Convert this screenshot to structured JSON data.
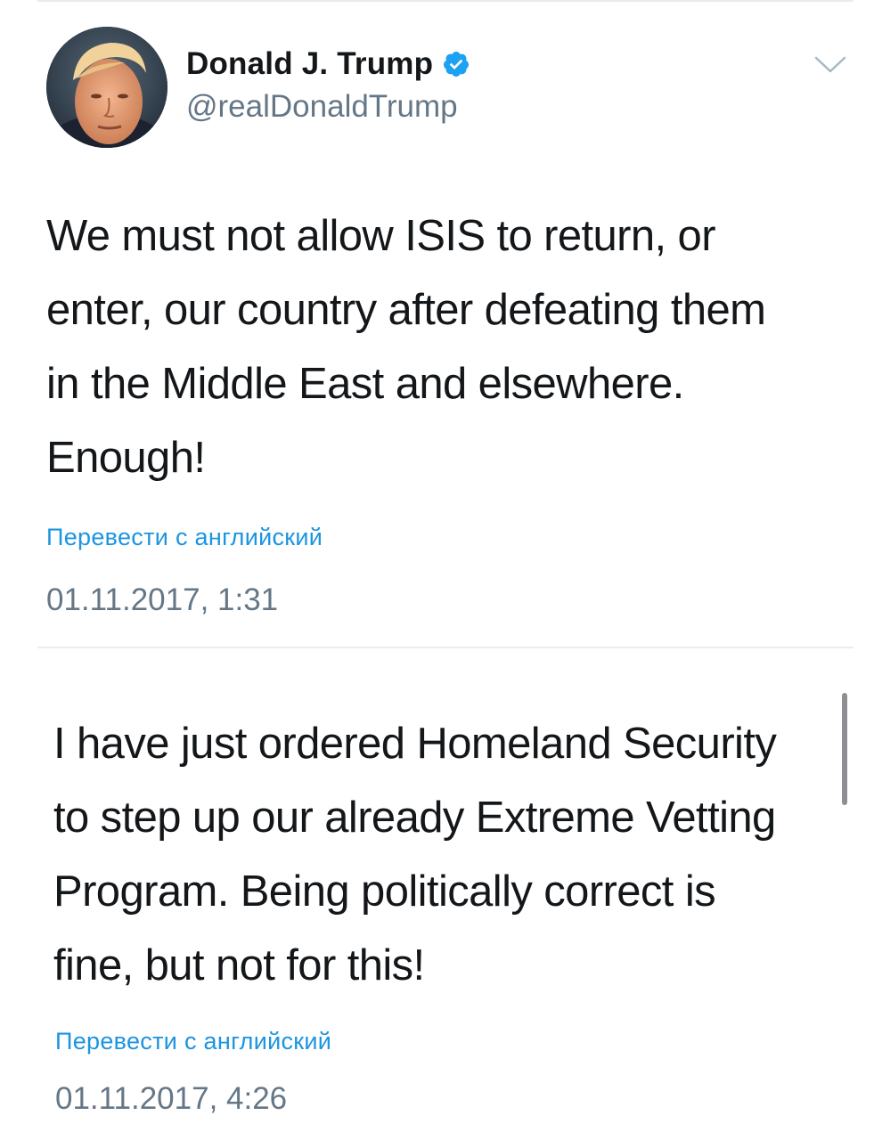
{
  "tweet1": {
    "display_name": "Donald J. Trump",
    "handle": "@realDonaldTrump",
    "text": "We must not allow ISIS to return, or\nenter, our country after defeating them\nin the Middle East and elsewhere.\nEnough!",
    "translate": "Перевести с английский",
    "timestamp": "01.11.2017, 1:31"
  },
  "tweet2": {
    "text": "I have just ordered Homeland Security\nto step up our already Extreme Vetting\nProgram. Being politically correct is\nfine, but not for this!",
    "translate": "Перевести с английский",
    "timestamp": "01.11.2017, 4:26"
  },
  "icons": {
    "verified": "verified-badge-icon",
    "menu": "chevron-down-icon"
  },
  "colors": {
    "link": "#1b95e0",
    "secondary_text": "#657786",
    "primary_text": "#14171a",
    "divider": "#e6ecf0"
  }
}
